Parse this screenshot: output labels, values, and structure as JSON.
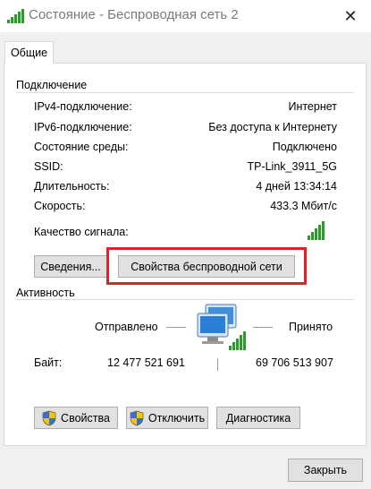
{
  "window": {
    "title": "Состояние - Беспроводная сеть 2",
    "close_glyph": "✕"
  },
  "tabs": [
    {
      "label": "Общие",
      "active": true
    }
  ],
  "connection": {
    "heading": "Подключение",
    "rows": [
      {
        "label": "IPv4-подключение:",
        "value": "Интернет"
      },
      {
        "label": "IPv6-подключение:",
        "value": "Без доступа к Интернету"
      },
      {
        "label": "Состояние среды:",
        "value": "Подключено"
      },
      {
        "label": "SSID:",
        "value": "TP-Link_3911_5G"
      },
      {
        "label": "Длительность:",
        "value": "4 дней 13:34:14"
      },
      {
        "label": "Скорость:",
        "value": "433.3 Мбит/с"
      }
    ],
    "signal_label": "Качество сигнала:",
    "signal_bars": 5,
    "details_button": "Сведения...",
    "wireless_props_button": "Свойства беспроводной сети"
  },
  "activity": {
    "heading": "Активность",
    "sent_label": "Отправлено",
    "received_label": "Принято",
    "bytes_label": "Байт:",
    "bytes_sent": "12 477 521 691",
    "bytes_received": "69 706 513 907"
  },
  "bottom_buttons": {
    "properties": "Свойства",
    "disconnect": "Отключить",
    "diagnostics": "Диагностика"
  },
  "footer": {
    "close_button": "Закрыть"
  },
  "colors": {
    "signal_green": "#2c9b2c",
    "highlight_red": "#e0222a",
    "button_bg": "#e1e1e1",
    "window_bg": "#f0f0f0"
  }
}
